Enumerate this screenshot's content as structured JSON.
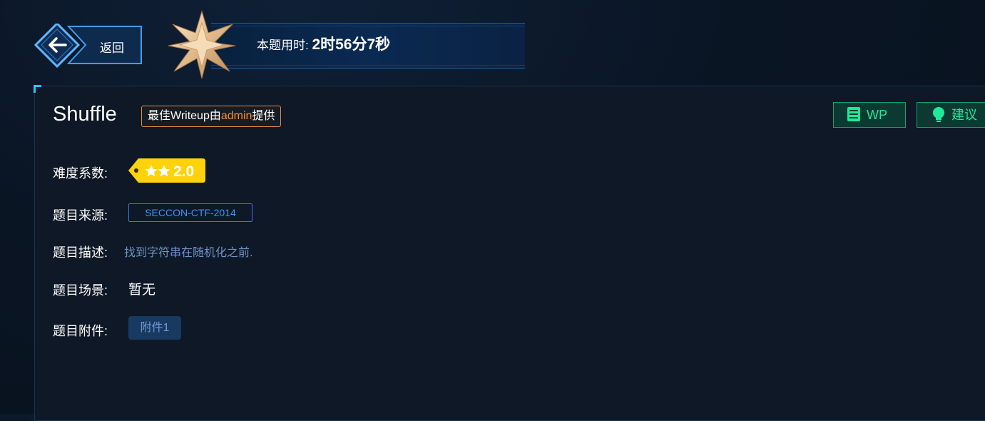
{
  "header": {
    "back_label": "返回",
    "timer_label": "本题用时: ",
    "timer_value": "2时56分7秒"
  },
  "challenge": {
    "title": "Shuffle",
    "writeup_prefix": "最佳Writeup由",
    "writeup_author": "admin",
    "writeup_suffix": "提供",
    "wp_button": "WP",
    "suggest_button": "建议",
    "difficulty_label": "难度系数:",
    "difficulty_value": "2.0",
    "difficulty_stars": 2,
    "source_label": "题目来源:",
    "source_value": "SECCON-CTF-2014",
    "desc_label": "题目描述:",
    "desc_value": "找到字符串在随机化之前.",
    "scene_label": "题目场景:",
    "scene_value": "暂无",
    "attach_label": "题目附件:",
    "attach_value": "附件1"
  },
  "colors": {
    "accent_green": "#1eea9a",
    "accent_blue": "#3a96ff",
    "accent_orange": "#ff8c2f",
    "star_tag_yellow": "#ffd20a"
  }
}
